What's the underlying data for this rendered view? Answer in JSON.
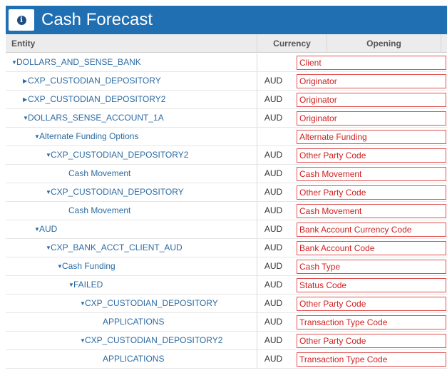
{
  "header": {
    "title": "Cash Forecast",
    "info_icon": "info-icon"
  },
  "columns": {
    "entity": "Entity",
    "currency": "Currency",
    "opening": "Opening"
  },
  "rows": [
    {
      "entity": "DOLLARS_AND_SENSE_BANK",
      "toggle": "expanded",
      "level": 1,
      "currency": "",
      "annotation": "Client"
    },
    {
      "entity": "CXP_CUSTODIAN_DEPOSITORY",
      "toggle": "collapsed",
      "level": 2,
      "currency": "AUD",
      "annotation": "Originator"
    },
    {
      "entity": "CXP_CUSTODIAN_DEPOSITORY2",
      "toggle": "collapsed",
      "level": 2,
      "currency": "AUD",
      "annotation": "Originator"
    },
    {
      "entity": "DOLLARS_SENSE_ACCOUNT_1A",
      "toggle": "expanded",
      "level": 2,
      "currency": "AUD",
      "annotation": "Originator"
    },
    {
      "entity": "Alternate Funding Options",
      "toggle": "expanded",
      "level": 3,
      "currency": "",
      "annotation": "Alternate Funding"
    },
    {
      "entity": "CXP_CUSTODIAN_DEPOSITORY2",
      "toggle": "expanded",
      "level": 4,
      "currency": "AUD",
      "annotation": "Other Party Code"
    },
    {
      "entity": "Cash Movement",
      "toggle": "none",
      "level": 5,
      "currency": "AUD",
      "annotation": "Cash Movement"
    },
    {
      "entity": "CXP_CUSTODIAN_DEPOSITORY",
      "toggle": "expanded",
      "level": 4,
      "currency": "AUD",
      "annotation": "Other Party Code"
    },
    {
      "entity": "Cash Movement",
      "toggle": "none",
      "level": 5,
      "currency": "AUD",
      "annotation": "Cash Movement"
    },
    {
      "entity": "AUD",
      "toggle": "expanded",
      "level": 3,
      "currency": "AUD",
      "annotation": "Bank Account Currency Code"
    },
    {
      "entity": "CXP_BANK_ACCT_CLIENT_AUD",
      "toggle": "expanded",
      "level": 4,
      "currency": "AUD",
      "annotation": "Bank Account Code"
    },
    {
      "entity": "Cash Funding",
      "toggle": "expanded",
      "level": 5,
      "currency": "AUD",
      "annotation": "Cash Type"
    },
    {
      "entity": "FAILED",
      "toggle": "expanded",
      "level": 6,
      "currency": "AUD",
      "annotation": "Status Code"
    },
    {
      "entity": "CXP_CUSTODIAN_DEPOSITORY",
      "toggle": "expanded",
      "level": 7,
      "currency": "AUD",
      "annotation": "Other Party Code"
    },
    {
      "entity": "APPLICATIONS",
      "toggle": "none",
      "level": 8,
      "currency": "AUD",
      "annotation": "Transaction Type Code"
    },
    {
      "entity": "CXP_CUSTODIAN_DEPOSITORY2",
      "toggle": "expanded",
      "level": 7,
      "currency": "AUD",
      "annotation": "Other Party Code"
    },
    {
      "entity": "APPLICATIONS",
      "toggle": "none",
      "level": 8,
      "currency": "AUD",
      "annotation": "Transaction Type Code"
    }
  ]
}
